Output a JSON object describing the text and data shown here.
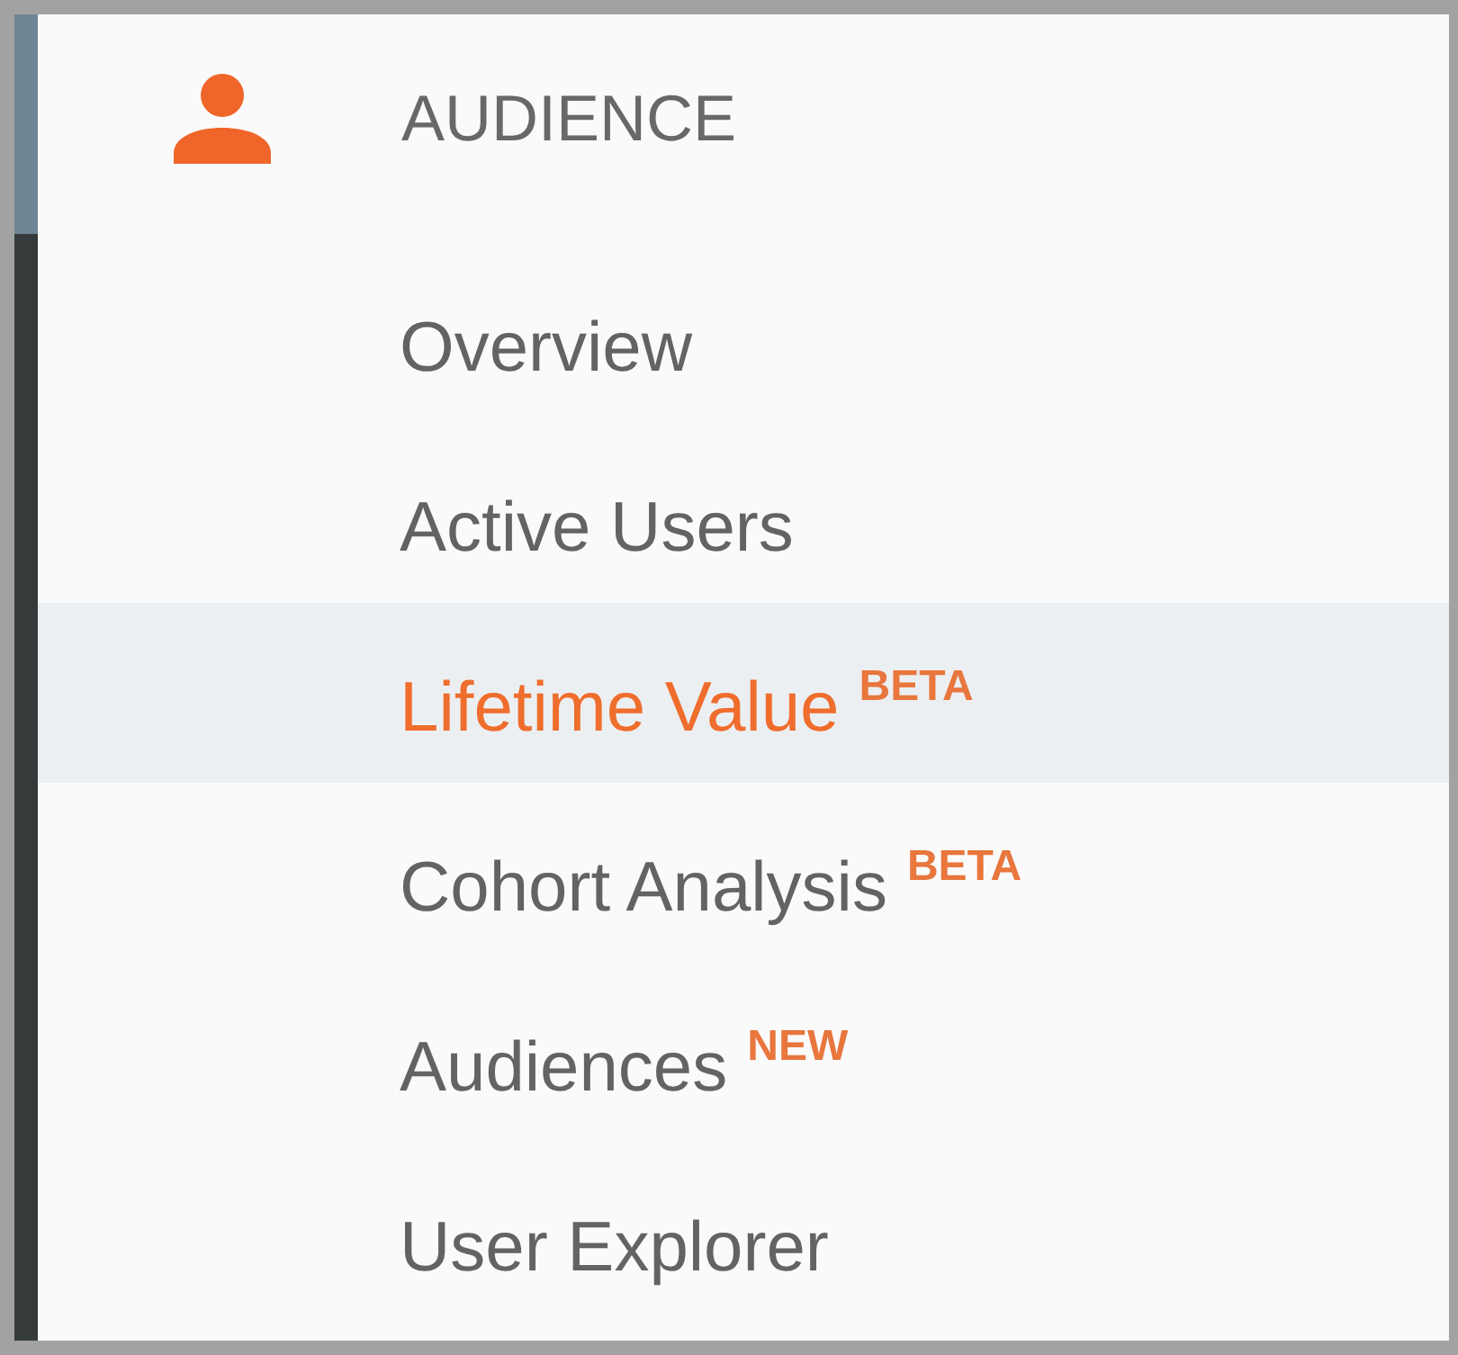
{
  "section": {
    "title": "AUDIENCE"
  },
  "items": [
    {
      "label": "Overview",
      "selected": false
    },
    {
      "label": "Active Users",
      "selected": false
    },
    {
      "label": "Lifetime Value",
      "badge": "BETA",
      "selected": true
    },
    {
      "label": "Cohort Analysis",
      "badge": "BETA",
      "selected": false
    },
    {
      "label": "Audiences",
      "badge": "NEW",
      "selected": false
    },
    {
      "label": "User Explorer",
      "selected": false
    }
  ]
}
